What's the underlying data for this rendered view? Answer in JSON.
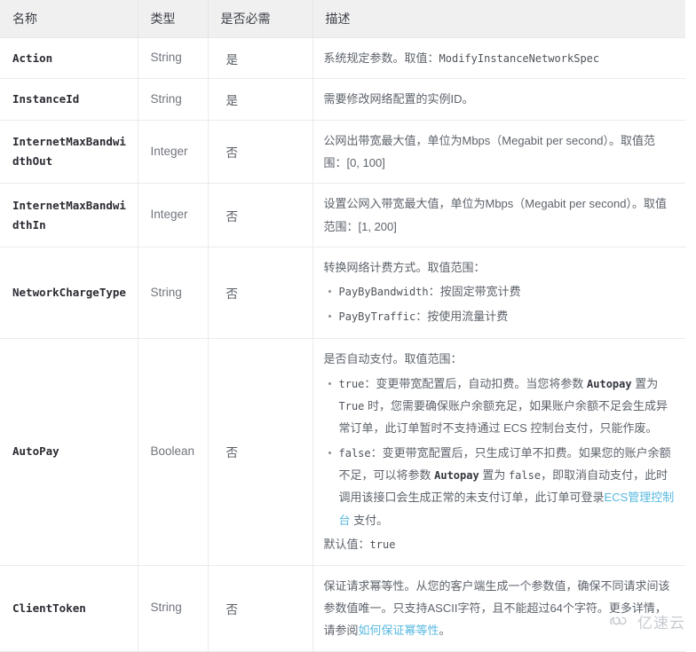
{
  "table": {
    "headers": [
      {
        "key": "name",
        "label": "名称"
      },
      {
        "key": "type",
        "label": "类型"
      },
      {
        "key": "required",
        "label": "是否必需"
      },
      {
        "key": "description",
        "label": "描述"
      }
    ],
    "rows": [
      {
        "name": "Action",
        "type": "String",
        "required": "是",
        "desc_intro": "系统规定参数。取值：",
        "desc_intro_code": "ModifyInstanceNetworkSpec"
      },
      {
        "name": "InstanceId",
        "type": "String",
        "required": "是",
        "desc_intro": "需要修改网络配置的实例ID。"
      },
      {
        "name": "InternetMaxBandwidthOut",
        "type": "Integer",
        "required": "否",
        "desc_intro": "公网出带宽最大值，单位为Mbps（Megabit per second）。取值范围：[0, 100]"
      },
      {
        "name": "InternetMaxBandwidthIn",
        "type": "Integer",
        "required": "否",
        "desc_intro": "设置公网入带宽最大值，单位为Mbps（Megabit per second）。取值范围：[1, 200]"
      },
      {
        "name": "NetworkChargeType",
        "type": "String",
        "required": "否",
        "desc_intro": "转换网络计费方式。取值范围：",
        "bullets": [
          {
            "code": "PayByBandwidth",
            "text": "：按固定带宽计费"
          },
          {
            "code": "PayByTraffic",
            "text": "：按使用流量计费"
          }
        ]
      },
      {
        "name": "AutoPay",
        "type": "Boolean",
        "required": "否",
        "desc_intro": "是否自动支付。取值范围：",
        "bullets_rich": [
          {
            "segments": [
              {
                "kind": "code",
                "text": "true"
              },
              {
                "kind": "text",
                "text": "：变更带宽配置后，自动扣费。当您将参数 "
              },
              {
                "kind": "code-bold",
                "text": "Autopay"
              },
              {
                "kind": "text",
                "text": " 置为 "
              },
              {
                "kind": "code",
                "text": "True"
              },
              {
                "kind": "text",
                "text": " 时，您需要确保账户余额充足，如果账户余额不足会生成异常订单，此订单暂时不支持通过 ECS 控制台支付，只能作废。"
              }
            ]
          },
          {
            "segments": [
              {
                "kind": "code",
                "text": "false"
              },
              {
                "kind": "text",
                "text": "：变更带宽配置后，只生成订单不扣费。如果您的账户余额不足，可以将参数 "
              },
              {
                "kind": "code-bold",
                "text": "Autopay"
              },
              {
                "kind": "text",
                "text": " 置为 "
              },
              {
                "kind": "code",
                "text": "false"
              },
              {
                "kind": "text",
                "text": "，即取消自动支付，此时调用该接口会生成正常的未支付订单，此订单可登录"
              },
              {
                "kind": "link",
                "text": "ECS管理控制台"
              },
              {
                "kind": "text",
                "text": " 支付。"
              }
            ]
          }
        ],
        "desc_footer_label": "默认值：",
        "desc_footer_code": "true"
      },
      {
        "name": "ClientToken",
        "type": "String",
        "required": "否",
        "desc_rich": [
          {
            "kind": "text",
            "text": "保证请求幂等性。从您的客户端生成一个参数值，确保不同请求间该参数值唯一。只支持ASCII字符，且不能超过64个字符。更多详情，请参阅"
          },
          {
            "kind": "link",
            "text": "如何保证幂等性"
          },
          {
            "kind": "text",
            "text": "。"
          }
        ]
      }
    ]
  },
  "watermark": {
    "text": "亿速云",
    "icon": "cloud-icon"
  },
  "colors": {
    "header_bg": "#f0f0f0",
    "border": "#ebebeb",
    "link": "#57b9e0",
    "text": "#5d636b",
    "name_text": "#2b2b33"
  }
}
